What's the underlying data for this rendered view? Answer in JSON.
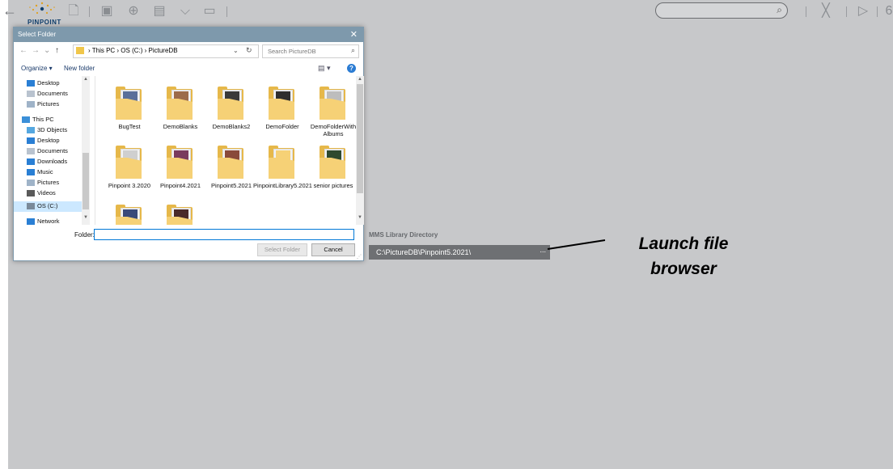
{
  "colors": {
    "app_background": "#c7c8ca",
    "dialog_titlebar": "#7e99ac",
    "field_background": "#6e7073",
    "folder_yellow": "#e6b84a",
    "accent_blue": "#2b7cd3"
  },
  "app": {
    "logo_text": "PINPOINT",
    "toolbar_icons": [
      "back-arrow-icon",
      "document-icon",
      "album-icon",
      "globe-icon",
      "list-icon",
      "tag-icon",
      "image-icon"
    ],
    "right_icons": [
      "close-x-icon",
      "play-icon"
    ],
    "right_edge_text": "6"
  },
  "dialog": {
    "title": "Select Folder",
    "close_glyph": "✕",
    "breadcrumb": "›  This PC  ›  OS (C:)  ›  PictureDB",
    "search_placeholder": "Search PictureDB",
    "organize_label": "Organize ▾",
    "new_folder_label": "New folder",
    "help_glyph": "?",
    "nav_items": [
      {
        "label": "Desktop",
        "icon": "desktop-icon"
      },
      {
        "label": "Documents",
        "icon": "documents-icon"
      },
      {
        "label": "Pictures",
        "icon": "pictures-icon"
      },
      {
        "label": "This PC",
        "icon": "computer-icon"
      },
      {
        "label": "3D Objects",
        "icon": "cube-icon"
      },
      {
        "label": "Desktop",
        "icon": "desktop-icon"
      },
      {
        "label": "Documents",
        "icon": "documents-icon"
      },
      {
        "label": "Downloads",
        "icon": "download-icon"
      },
      {
        "label": "Music",
        "icon": "music-icon"
      },
      {
        "label": "Pictures",
        "icon": "pictures-icon"
      },
      {
        "label": "Videos",
        "icon": "video-icon"
      },
      {
        "label": "OS (C:)",
        "icon": "drive-icon"
      },
      {
        "label": "Network",
        "icon": "network-icon"
      }
    ],
    "folders": [
      {
        "label": "BugTest",
        "thumb": "#5a6f9a"
      },
      {
        "label": "DemoBlanks",
        "thumb": "#9c6b4a"
      },
      {
        "label": "DemoBlanks2",
        "thumb": "#3a3a3a"
      },
      {
        "label": "DemoFolder",
        "thumb": "#2e2e2e"
      },
      {
        "label": "DemoFolderWith Albums",
        "thumb": "#bdbdbd"
      },
      {
        "label": "Pinpoint 3.2020",
        "thumb": "#cfcfcf"
      },
      {
        "label": "Pinpoint4.2021",
        "thumb": "#7a3b5e"
      },
      {
        "label": "Pinpoint5.2021",
        "thumb": "#8a4a3a"
      },
      {
        "label": "PinpointLibrary5.2021",
        "thumb": "#f6d176"
      },
      {
        "label": "senior pictures",
        "thumb": "#2f4a2f"
      },
      {
        "label": "",
        "thumb": "#3a4a7a"
      },
      {
        "label": "",
        "thumb": "#4a2a2a"
      }
    ],
    "folder_field_label": "Folder:",
    "folder_field_value": "",
    "select_button": "Select Folder",
    "cancel_button": "Cancel"
  },
  "library": {
    "label": "MMS Library Directory",
    "path": "C:\\PictureDB\\Pinpoint5.2021\\",
    "browse_glyph": "..."
  },
  "annotation": {
    "text_line1": "Launch file",
    "text_line2": "browser"
  }
}
